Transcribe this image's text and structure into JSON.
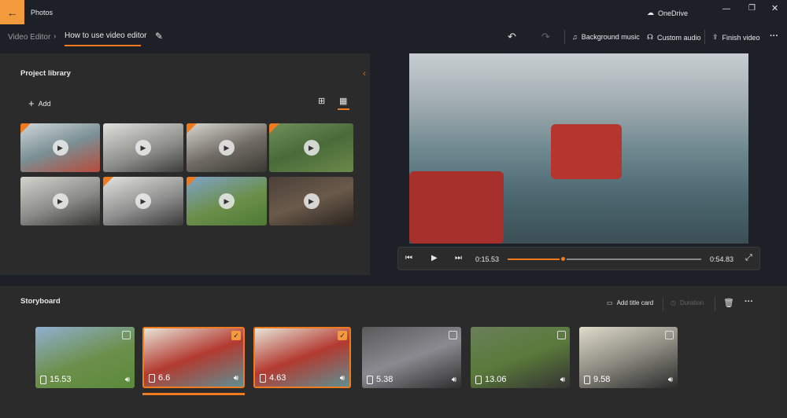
{
  "app": {
    "title": "Photos",
    "onedrive": "OneDrive"
  },
  "breadcrumb": {
    "parent": "Video Editor",
    "current": "How to use video editor"
  },
  "toolbar": {
    "background_music": "Background music",
    "custom_audio": "Custom audio",
    "finish_video": "Finish video"
  },
  "library": {
    "title": "Project library",
    "add": "Add",
    "items": [
      {
        "orange": true
      },
      {
        "orange": false
      },
      {
        "orange": true
      },
      {
        "orange": true
      },
      {
        "orange": false
      },
      {
        "orange": true
      },
      {
        "orange": true
      },
      {
        "orange": false
      }
    ]
  },
  "player": {
    "current_time": "0:15.53",
    "total_time": "0:54.83",
    "progress": 0.283
  },
  "storyboard": {
    "title": "Storyboard",
    "add_title_card": "Add title card",
    "duration": "Duration",
    "clips": [
      {
        "duration": "15.53",
        "selected": false
      },
      {
        "duration": "6.6",
        "selected": true
      },
      {
        "duration": "4.63",
        "selected": true
      },
      {
        "duration": "5.38",
        "selected": false
      },
      {
        "duration": "13.06",
        "selected": false
      },
      {
        "duration": "9.58",
        "selected": false
      }
    ]
  },
  "colors": {
    "accent": "#f07b1f"
  }
}
